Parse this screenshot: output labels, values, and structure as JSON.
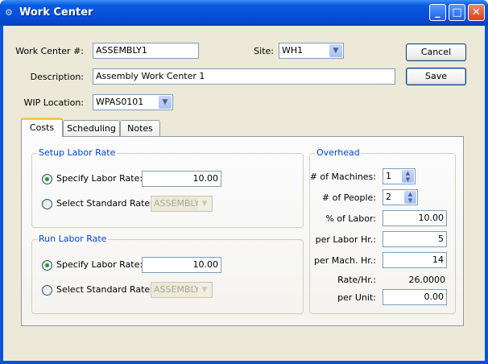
{
  "window": {
    "title": "Work Center"
  },
  "form": {
    "work_center_label": "Work Center #:",
    "work_center_value": "ASSEMBLY1",
    "site_label": "Site:",
    "site_value": "WH1",
    "description_label": "Description:",
    "description_value": "Assembly Work Center 1",
    "wip_label": "WIP Location:",
    "wip_value": "WPAS0101"
  },
  "buttons": {
    "cancel": "Cancel",
    "save": "Save"
  },
  "tabs": [
    {
      "label": "Costs"
    },
    {
      "label": "Scheduling"
    },
    {
      "label": "Notes"
    }
  ],
  "setup": {
    "title": "Setup Labor Rate",
    "specify_label": "Specify Labor Rate:",
    "specify_value": "10.00",
    "standard_label": "Select Standard Rate:",
    "standard_value": "ASSEMBLY"
  },
  "run": {
    "title": "Run Labor Rate",
    "specify_label": "Specify Labor Rate:",
    "specify_value": "10.00",
    "standard_label": "Select Standard Rate:",
    "standard_value": "ASSEMBLY"
  },
  "overhead": {
    "title": "Overhead",
    "machines_label": "# of Machines:",
    "machines_value": "1",
    "people_label": "# of People:",
    "people_value": "2",
    "pct_label": "% of Labor:",
    "pct_value": "10.00",
    "per_labor_label": "per Labor Hr.:",
    "per_labor_value": "5",
    "per_mach_label": "per Mach. Hr.:",
    "per_mach_value": "14",
    "rate_label": "Rate/Hr.:",
    "rate_value": "26.0000",
    "per_unit_label": "per Unit:",
    "per_unit_value": "0.00"
  }
}
